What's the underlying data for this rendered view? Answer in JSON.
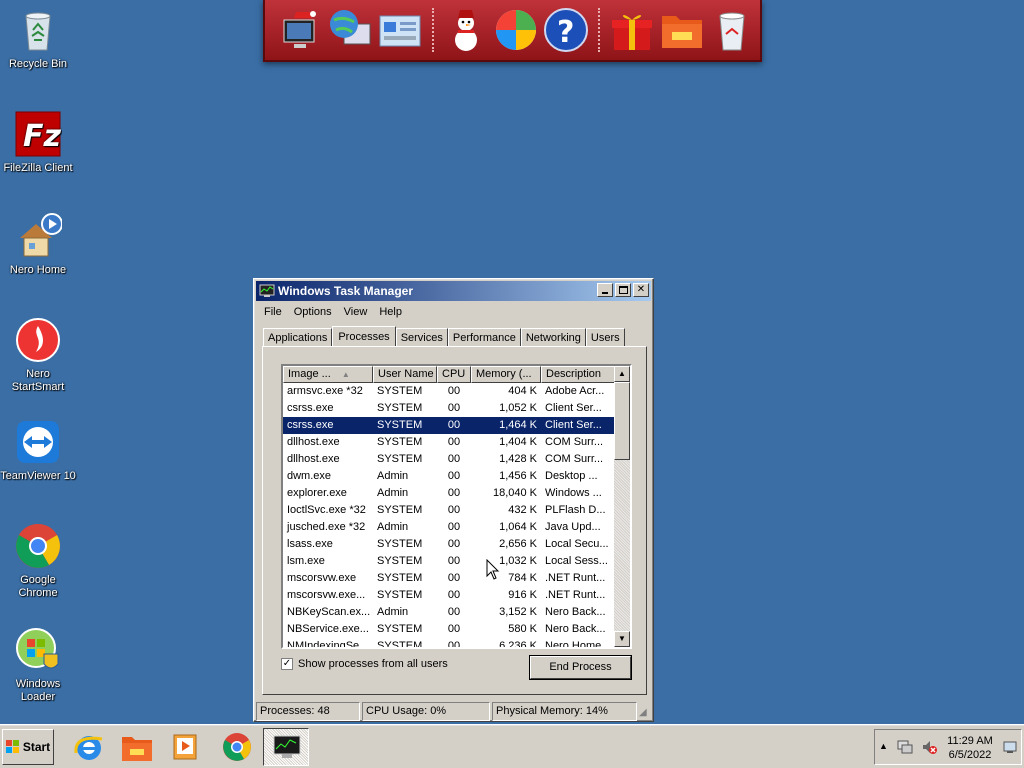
{
  "desktop": {
    "icons": [
      {
        "label": "Recycle Bin",
        "icon": "recycle-bin-icon"
      },
      {
        "label": "FileZilla Client",
        "icon": "filezilla-icon"
      },
      {
        "label": "Nero Home",
        "icon": "nero-home-icon"
      },
      {
        "label": "Nero StartSmart",
        "icon": "nero-startsmart-icon"
      },
      {
        "label": "TeamViewer 10",
        "icon": "teamviewer-icon"
      },
      {
        "label": "Google Chrome",
        "icon": "chrome-icon"
      },
      {
        "label": "Windows Loader",
        "icon": "windows-loader-icon"
      }
    ]
  },
  "dock": {
    "items": [
      "computer-icon",
      "network-globe-icon",
      "control-panel-icon",
      "snowman-icon",
      "windows-ball-icon",
      "help-icon",
      "gift-icon",
      "folder-icon",
      "recycle-bin-icon"
    ]
  },
  "task_manager": {
    "title": "Windows Task Manager",
    "menu": [
      "File",
      "Options",
      "View",
      "Help"
    ],
    "tabs": [
      "Applications",
      "Processes",
      "Services",
      "Performance",
      "Networking",
      "Users"
    ],
    "active_tab": "Processes",
    "columns": [
      "Image ...",
      "User Name",
      "CPU",
      "Memory (...",
      "Description"
    ],
    "rows": [
      [
        "armsvc.exe *32",
        "SYSTEM",
        "00",
        "404 K",
        "Adobe Acr..."
      ],
      [
        "csrss.exe",
        "SYSTEM",
        "00",
        "1,052 K",
        "Client Ser..."
      ],
      [
        "csrss.exe",
        "SYSTEM",
        "00",
        "1,464 K",
        "Client Ser..."
      ],
      [
        "dllhost.exe",
        "SYSTEM",
        "00",
        "1,404 K",
        "COM Surr..."
      ],
      [
        "dllhost.exe",
        "SYSTEM",
        "00",
        "1,428 K",
        "COM Surr..."
      ],
      [
        "dwm.exe",
        "Admin",
        "00",
        "1,456 K",
        "Desktop ..."
      ],
      [
        "explorer.exe",
        "Admin",
        "00",
        "18,040 K",
        "Windows ..."
      ],
      [
        "IoctlSvc.exe *32",
        "SYSTEM",
        "00",
        "432 K",
        "PLFlash D..."
      ],
      [
        "jusched.exe *32",
        "Admin",
        "00",
        "1,064 K",
        "Java Upd..."
      ],
      [
        "lsass.exe",
        "SYSTEM",
        "00",
        "2,656 K",
        "Local Secu..."
      ],
      [
        "lsm.exe",
        "SYSTEM",
        "00",
        "1,032 K",
        "Local Sess..."
      ],
      [
        "mscorsvw.exe",
        "SYSTEM",
        "00",
        "784 K",
        ".NET Runt..."
      ],
      [
        "mscorsvw.exe...",
        "SYSTEM",
        "00",
        "916 K",
        ".NET Runt..."
      ],
      [
        "NBKeyScan.ex...",
        "Admin",
        "00",
        "3,152 K",
        "Nero Back..."
      ],
      [
        "NBService.exe...",
        "SYSTEM",
        "00",
        "580 K",
        "Nero Back..."
      ],
      [
        "NMIndexingSe...",
        "SYSTEM",
        "00",
        "6,236 K",
        "Nero Home"
      ]
    ],
    "selected_row": 2,
    "show_all_label": "Show processes from all users",
    "show_all_checked": true,
    "end_process_label": "End Process",
    "status": {
      "processes": "Processes: 48",
      "cpu": "CPU Usage: 0%",
      "memory": "Physical Memory: 14%"
    }
  },
  "taskbar": {
    "start_label": "Start",
    "pinned": [
      "internet-explorer-icon",
      "folder-icon",
      "media-player-icon",
      "chrome-icon",
      "task-manager-icon"
    ],
    "clock_time": "11:29 AM",
    "clock_date": "6/5/2022"
  }
}
